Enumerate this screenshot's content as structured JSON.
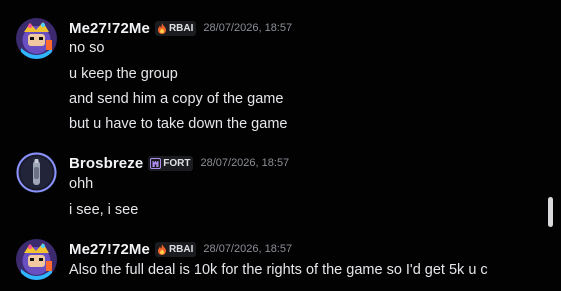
{
  "messages": [
    {
      "username": "Me27!72Me",
      "tag": {
        "label": "RBAI",
        "icon": "fire-icon"
      },
      "timestamp": "28/07/2026, 18:57",
      "lines": [
        "no so",
        "u keep the group",
        "and send him a copy of the game",
        "but u have to take down the game"
      ]
    },
    {
      "username": "Brosbreze",
      "tag": {
        "label": "FORT",
        "icon": "castle-icon"
      },
      "timestamp": "28/07/2026, 18:57",
      "lines": [
        "ohh",
        "i see, i see"
      ]
    },
    {
      "username": "Me27!72Me",
      "tag": {
        "label": "RBAI",
        "icon": "fire-icon"
      },
      "timestamp": "28/07/2026, 18:57",
      "lines": [
        "Also the full deal is 10k for the rights of the game so I'd get 5k u c"
      ]
    }
  ],
  "colors": {
    "background": "#020203",
    "username": "#f2f3f5",
    "timestamp": "#8c8f96",
    "fire": "#f0642a",
    "fort": "#b18cf0"
  }
}
